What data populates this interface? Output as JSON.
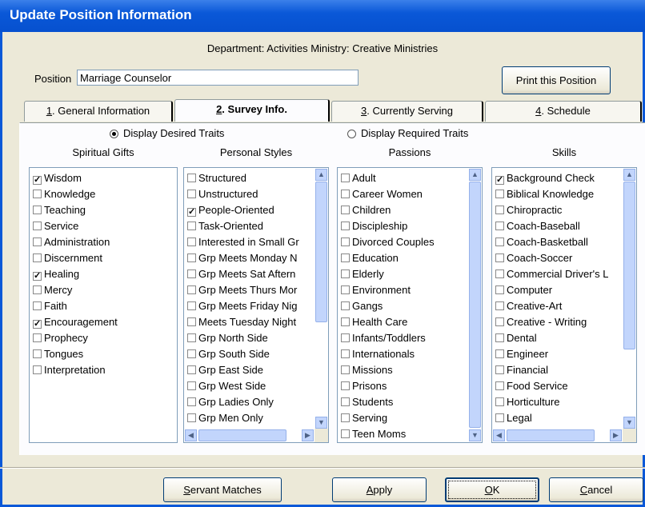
{
  "window": {
    "title": "Update Position Information"
  },
  "header": {
    "department_line": "Department: Activities   Ministry: Creative Ministries"
  },
  "position": {
    "label": "Position",
    "value": "Marriage Counselor"
  },
  "print_button": "Print this Position",
  "tabs": [
    {
      "num": "1",
      "label": ". General Information",
      "active": false
    },
    {
      "num": "2",
      "label": ". Survey Info.",
      "active": true
    },
    {
      "num": "3",
      "label": ". Currently Serving",
      "active": false
    },
    {
      "num": "4",
      "label": ". Schedule",
      "active": false
    }
  ],
  "display_options": {
    "desired": {
      "label": "Display Desired Traits",
      "selected": true
    },
    "required": {
      "label": "Display Required Traits",
      "selected": false
    }
  },
  "columns": {
    "spiritual_gifts": {
      "header": "Spiritual Gifts",
      "items": [
        {
          "label": "Wisdom",
          "checked": true
        },
        {
          "label": "Knowledge",
          "checked": false
        },
        {
          "label": "Teaching",
          "checked": false
        },
        {
          "label": "Service",
          "checked": false
        },
        {
          "label": "Administration",
          "checked": false
        },
        {
          "label": "Discernment",
          "checked": false
        },
        {
          "label": "Healing",
          "checked": true
        },
        {
          "label": "Mercy",
          "checked": false
        },
        {
          "label": "Faith",
          "checked": false
        },
        {
          "label": "Encouragement",
          "checked": true
        },
        {
          "label": "Prophecy",
          "checked": false
        },
        {
          "label": "Tongues",
          "checked": false
        },
        {
          "label": "Interpretation",
          "checked": false
        }
      ]
    },
    "personal_styles": {
      "header": "Personal Styles",
      "items": [
        {
          "label": "Structured",
          "checked": false
        },
        {
          "label": "Unstructured",
          "checked": false
        },
        {
          "label": "People-Oriented",
          "checked": true
        },
        {
          "label": "Task-Oriented",
          "checked": false
        },
        {
          "label": "Interested in Small Gr",
          "checked": false
        },
        {
          "label": "Grp Meets Monday N",
          "checked": false
        },
        {
          "label": "Grp Meets Sat Aftern",
          "checked": false
        },
        {
          "label": "Grp Meets Thurs Mor",
          "checked": false
        },
        {
          "label": "Grp Meets Friday Nig",
          "checked": false
        },
        {
          "label": "Meets Tuesday Night",
          "checked": false
        },
        {
          "label": "Grp North Side",
          "checked": false
        },
        {
          "label": "Grp South Side",
          "checked": false
        },
        {
          "label": "Grp East Side",
          "checked": false
        },
        {
          "label": "Grp West Side",
          "checked": false
        },
        {
          "label": "Grp Ladies Only",
          "checked": false
        },
        {
          "label": "Grp Men Only",
          "checked": false
        }
      ]
    },
    "passions": {
      "header": "Passions",
      "items": [
        {
          "label": "Adult",
          "checked": false
        },
        {
          "label": "Career Women",
          "checked": false
        },
        {
          "label": "Children",
          "checked": false
        },
        {
          "label": "Discipleship",
          "checked": false
        },
        {
          "label": "Divorced Couples",
          "checked": false
        },
        {
          "label": "Education",
          "checked": false
        },
        {
          "label": "Elderly",
          "checked": false
        },
        {
          "label": "Environment",
          "checked": false
        },
        {
          "label": "Gangs",
          "checked": false
        },
        {
          "label": "Health Care",
          "checked": false
        },
        {
          "label": "Infants/Toddlers",
          "checked": false
        },
        {
          "label": "Internationals",
          "checked": false
        },
        {
          "label": "Missions",
          "checked": false
        },
        {
          "label": "Prisons",
          "checked": false
        },
        {
          "label": "Students",
          "checked": false
        },
        {
          "label": "Serving",
          "checked": false
        },
        {
          "label": "Teen Moms",
          "checked": false
        }
      ]
    },
    "skills": {
      "header": "Skills",
      "items": [
        {
          "label": "Background Check",
          "checked": true
        },
        {
          "label": "Biblical Knowledge",
          "checked": false
        },
        {
          "label": "Chiropractic",
          "checked": false
        },
        {
          "label": "Coach-Baseball",
          "checked": false
        },
        {
          "label": "Coach-Basketball",
          "checked": false
        },
        {
          "label": "Coach-Soccer",
          "checked": false
        },
        {
          "label": "Commercial Driver's L",
          "checked": false
        },
        {
          "label": "Computer",
          "checked": false
        },
        {
          "label": "Creative-Art",
          "checked": false
        },
        {
          "label": "Creative - Writing",
          "checked": false
        },
        {
          "label": "Dental",
          "checked": false
        },
        {
          "label": "Engineer",
          "checked": false
        },
        {
          "label": "Financial",
          "checked": false
        },
        {
          "label": "Food Service",
          "checked": false
        },
        {
          "label": "Horticulture",
          "checked": false
        },
        {
          "label": "Legal",
          "checked": false
        }
      ]
    }
  },
  "buttons": {
    "servant_matches": {
      "key": "S",
      "rest": "ervant Matches"
    },
    "apply": {
      "key": "A",
      "rest": "pply"
    },
    "ok": {
      "key": "O",
      "rest": "K"
    },
    "cancel": {
      "key": "C",
      "rest": "ancel"
    }
  }
}
